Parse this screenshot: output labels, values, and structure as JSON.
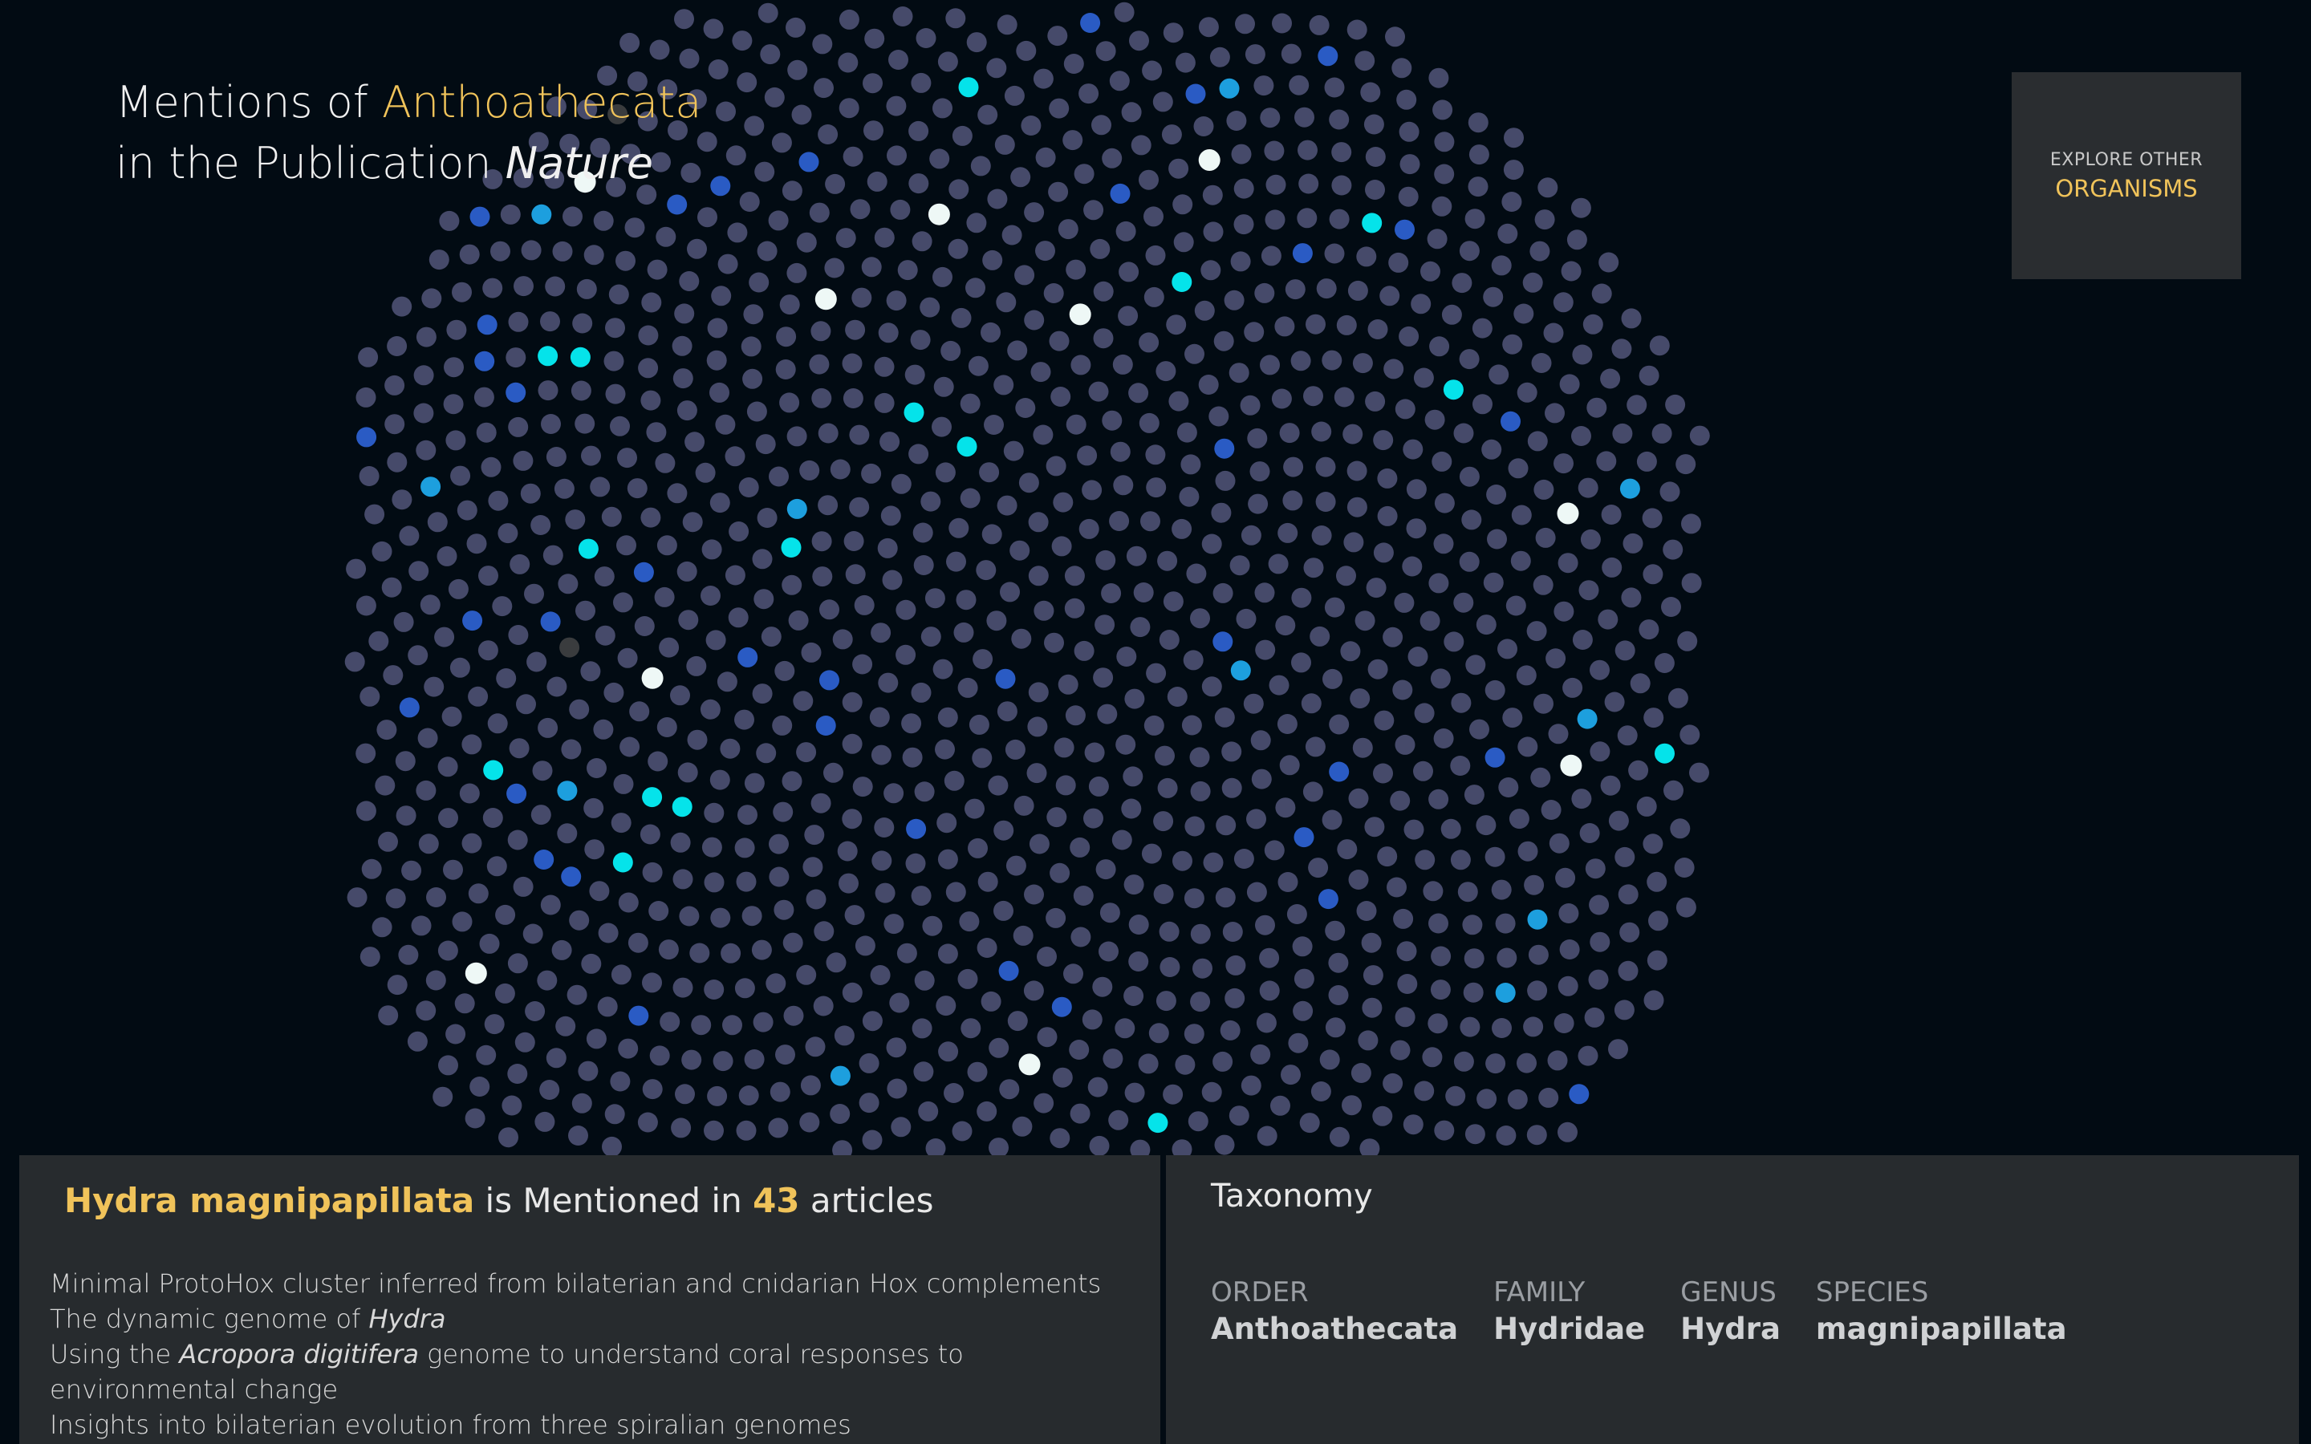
{
  "title": {
    "line1_prefix": "Mentions of ",
    "line1_highlight": "Anthoathecata",
    "line2_prefix": "in the Publication ",
    "line2_italic": "Nature"
  },
  "explore_button": {
    "line1": "EXPLORE OTHER",
    "line2": "ORGANISMS"
  },
  "mentions": {
    "organism": "Hydra magnipapillata",
    "middle": " is Mentioned in ",
    "count": "43",
    "suffix": " articles",
    "articles": [
      {
        "before": "Minimal ProtoHox cluster inferred from bilaterian and cnidarian Hox complements",
        "italic": "",
        "after": ""
      },
      {
        "before": "The dynamic genome of ",
        "italic": "Hydra",
        "after": ""
      },
      {
        "before": "Using the ",
        "italic": "Acropora digitifera",
        "after": " genome to understand coral responses to environmental change"
      },
      {
        "before": "Insights into bilaterian evolution from three spiralian genomes",
        "italic": "",
        "after": ""
      }
    ]
  },
  "taxonomy": {
    "title": "Taxonomy",
    "ranks": [
      {
        "label": "ORDER",
        "value": "Anthoathecata"
      },
      {
        "label": "FAMILY",
        "value": "Hydridae"
      },
      {
        "label": "GENUS",
        "value": "Hydra"
      },
      {
        "label": "SPECIES",
        "value": "magnipapillata"
      }
    ]
  },
  "colors": {
    "background": "#020b13",
    "dot_default": "#464a6a",
    "dot_cyan": "#05e3ea",
    "dot_blue": "#2a5bc4",
    "dot_lightblue": "#1d9fde",
    "dot_white": "#eef8f6",
    "dot_gray": "#3a3c3e",
    "accent": "#f0c35a"
  }
}
